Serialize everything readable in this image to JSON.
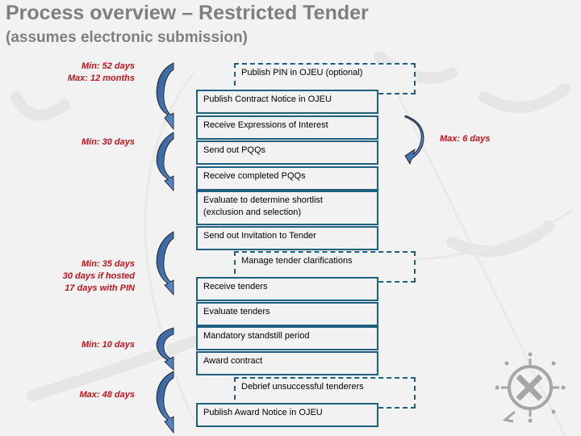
{
  "title": "Process overview – Restricted Tender",
  "subtitle": "(assumes electronic submission)",
  "colors": {
    "title": "#7f7f7f",
    "step_border": "#1f5f80",
    "note_text": "#c0141c",
    "arrow_fill": "#4a76b0",
    "background": "#f2f2f2"
  },
  "steps": [
    {
      "label": "Publish PIN in OJEU (optional)",
      "style": "dashed"
    },
    {
      "label": "Publish Contract Notice in OJEU",
      "style": "solid"
    },
    {
      "label": "Receive Expressions of Interest",
      "style": "solid"
    },
    {
      "label": "Send out PQQs",
      "style": "solid"
    },
    {
      "label": "Receive completed PQQs",
      "style": "solid"
    },
    {
      "label_line1": "Evaluate to determine shortlist",
      "label_line2": "(exclusion and selection)",
      "style": "solid"
    },
    {
      "label": "Send out Invitation to Tender",
      "style": "solid"
    },
    {
      "label": "Manage tender clarifications",
      "style": "dashed"
    },
    {
      "label": "Receive tenders",
      "style": "solid"
    },
    {
      "label": "Evaluate tenders",
      "style": "solid"
    },
    {
      "label": "Mandatory standstill period",
      "style": "solid"
    },
    {
      "label": "Award contract",
      "style": "solid"
    },
    {
      "label": "Debrief unsuccessful tenderers",
      "style": "dashed"
    },
    {
      "label": "Publish Award Notice in OJEU",
      "style": "solid"
    }
  ],
  "notes": [
    {
      "lines": [
        "Min:   52 days",
        "Max:  12 months"
      ]
    },
    {
      "lines": [
        "Min:   30 days"
      ]
    },
    {
      "lines": [
        "Max:   6 days"
      ]
    },
    {
      "lines": [
        "Min:   35 days",
        "30 days if hosted",
        "17 days with PIN"
      ]
    },
    {
      "lines": [
        "Min:   10 days"
      ]
    },
    {
      "lines": [
        "Max:   48 days"
      ]
    }
  ],
  "icons": {
    "arrow": "curved-arrow-icon",
    "logo": "compass-logo-icon"
  }
}
